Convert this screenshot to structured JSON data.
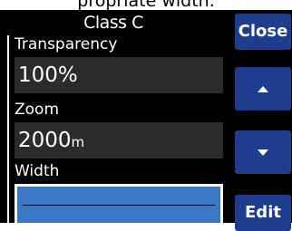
{
  "caption": "propriate width.",
  "dialog": {
    "title": "Class C",
    "fields": [
      {
        "label": "Transparency",
        "value": "100%"
      },
      {
        "label": "Zoom",
        "value": "2000",
        "unit": "m"
      },
      {
        "label": "Width"
      }
    ]
  },
  "buttons": {
    "close": "Close",
    "up_icon": "arrow-up-icon",
    "down_icon": "arrow-down-icon",
    "edit": "Edit"
  }
}
